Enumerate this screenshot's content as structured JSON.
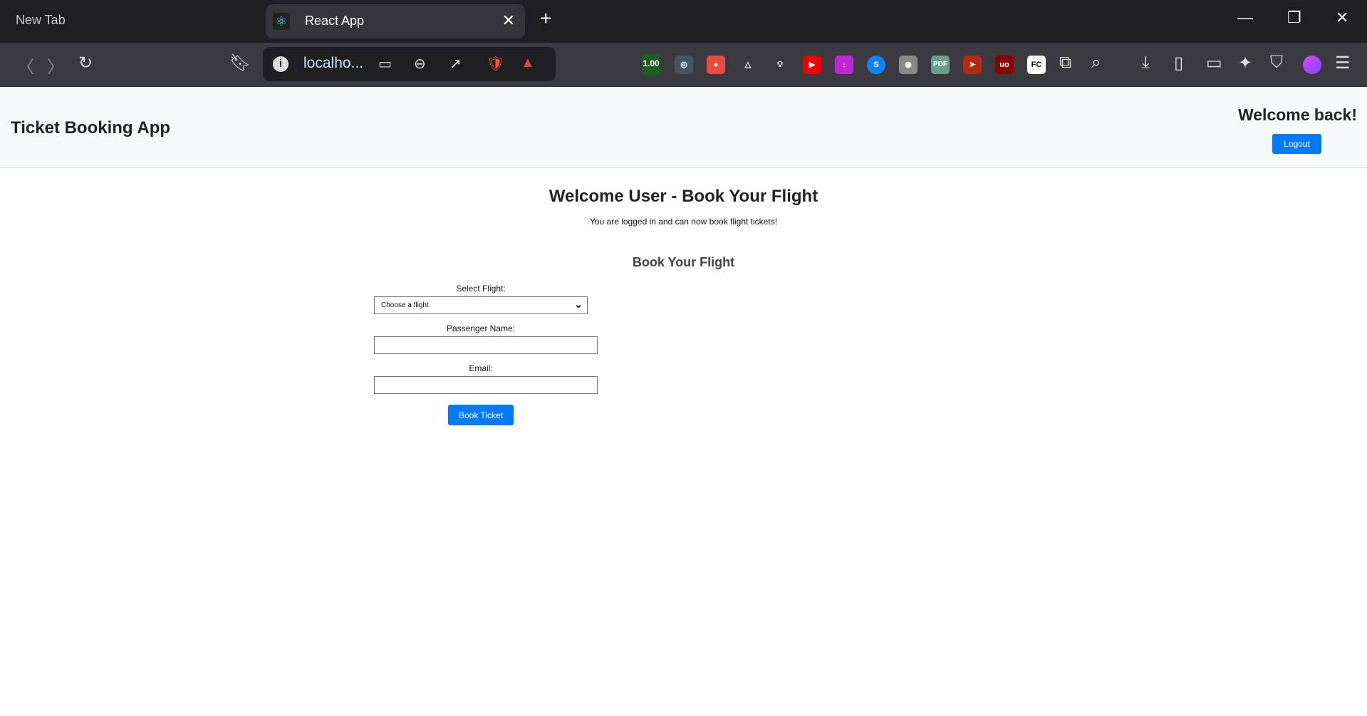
{
  "browser": {
    "tabs": [
      {
        "label": "New Tab"
      },
      {
        "label": "React App",
        "active": true
      }
    ],
    "url": "localho...",
    "extensions": [
      "1.00"
    ]
  },
  "header": {
    "title": "Ticket Booking App",
    "welcome": "Welcome back!",
    "logout_label": "Logout"
  },
  "main": {
    "heading": "Welcome User - Book Your Flight",
    "subtext": "You are logged in and can now book flight tickets!",
    "form_title": "Book Your Flight",
    "flight_label": "Select Flight:",
    "flight_value": "Choose a flight",
    "name_label": "Passenger Name:",
    "name_value": "",
    "email_label": "Email:",
    "email_value": "",
    "submit_label": "Book Ticket"
  },
  "colors": {
    "primary": "#007bff",
    "header_bg": "#f8f9fa"
  }
}
